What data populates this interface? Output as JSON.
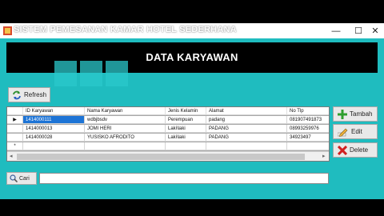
{
  "window": {
    "title": "SISTEM PEMESANAN KAMAR HOTEL SEDERHANA",
    "minimize_glyph": "—",
    "maximize_glyph": "☐",
    "close_glyph": "✕"
  },
  "header": {
    "title": "DATA KARYAWAN"
  },
  "toolbar": {
    "refresh_label": "Refresh"
  },
  "grid": {
    "columns": [
      "ID Karyawan",
      "Nama Karyawan",
      "Jenis Kelamin",
      "Alamat",
      "No Tlp"
    ],
    "rows": [
      {
        "indicator": "▶",
        "cells": [
          "1414000111",
          "wdbjbsdv",
          "Perempuan",
          "padang",
          "081907491873"
        ]
      },
      {
        "indicator": "",
        "cells": [
          "1414000013",
          "JOMI HERI",
          "Laki\\laki",
          "PADANG",
          "08993259976"
        ]
      },
      {
        "indicator": "",
        "cells": [
          "1414000028",
          "YUSISKO AFRODITO",
          "Laki\\laki",
          "PADANG",
          "34923497"
        ]
      },
      {
        "indicator": "*",
        "cells": [
          "",
          "",
          "",
          "",
          ""
        ]
      }
    ],
    "selected_row": 0
  },
  "actions": {
    "add_label": "Tambah",
    "edit_label": "Edit",
    "delete_label": "Delete"
  },
  "search": {
    "button_label": "Cari",
    "value": "",
    "placeholder": ""
  },
  "colors": {
    "background": "#1fbcbf",
    "header": "#000000",
    "selection": "#1d74d6"
  }
}
